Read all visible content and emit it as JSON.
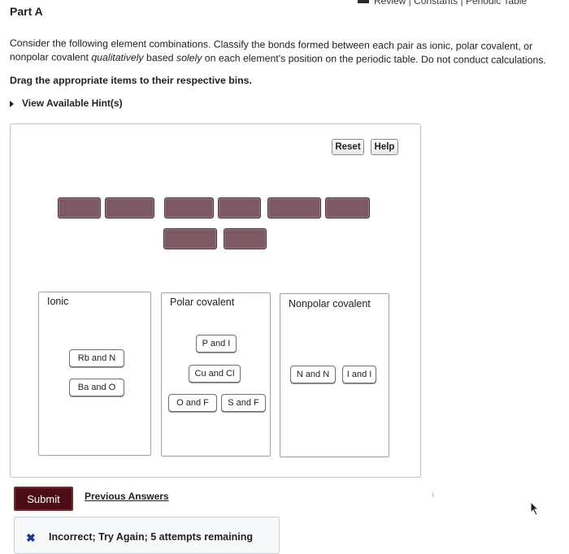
{
  "header": {
    "links_text": "Review | Constants | Periodic Table",
    "part_label": "Part A"
  },
  "instructions": {
    "line1": "Consider the following element combinations. Classify the bonds formed between each pair as ionic, polar covalent, or",
    "line2_a": "nonpolar covalent ",
    "line2_b": "qualitatively",
    "line2_c": " based ",
    "line2_d": "solely",
    "line2_e": " on each element's position on the periodic table. Do not conduct calculations.",
    "drag_text": "Drag the appropriate items to their respective bins.",
    "hint_text": "View Available Hint(s)"
  },
  "toolbar": {
    "reset_label": "Reset",
    "help_label": "Help"
  },
  "answer_tiles": {
    "count": 8
  },
  "bins": [
    {
      "title": "Ionic",
      "items": [
        "Rb and N",
        "Ba and O"
      ]
    },
    {
      "title": "Polar covalent",
      "items": [
        "P and I",
        "Cu and Cl",
        "O and F",
        "S and F"
      ]
    },
    {
      "title": "Nonpolar covalent",
      "items": [
        "N and N",
        "I and I"
      ]
    }
  ],
  "actions": {
    "submit_label": "Submit",
    "previous_answers_label": "Previous Answers"
  },
  "feedback": {
    "icon": "x-icon",
    "text": "Incorrect; Try Again; 5 attempts remaining"
  },
  "colors": {
    "tile_fill": "#7d5a63",
    "submit_bg": "#4b0e16",
    "feedback_icon": "#1e3a8a"
  }
}
